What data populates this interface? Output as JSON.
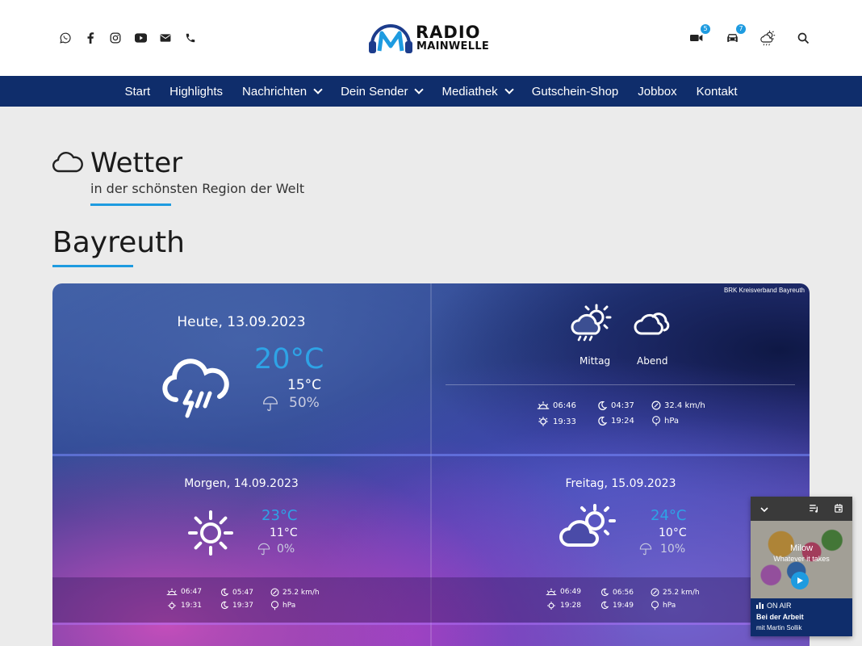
{
  "header": {
    "social": [
      "whatsapp-icon",
      "facebook-icon",
      "instagram-icon",
      "youtube-icon",
      "mail-icon",
      "phone-icon"
    ],
    "logo_line1": "RADIO",
    "logo_line2": "MAINWELLE",
    "tools": {
      "camera_badge": "5",
      "car_badge": "7"
    }
  },
  "nav": {
    "items": [
      {
        "label": "Start"
      },
      {
        "label": "Highlights"
      },
      {
        "label": "Nachrichten",
        "dropdown": true
      },
      {
        "label": "Dein Sender",
        "dropdown": true
      },
      {
        "label": "Mediathek",
        "dropdown": true
      },
      {
        "label": "Gutschein-Shop"
      },
      {
        "label": "Jobbox"
      },
      {
        "label": "Kontakt"
      }
    ]
  },
  "page": {
    "title": "Wetter",
    "subtitle": "in der schönsten Region der Welt",
    "city": "Bayreuth"
  },
  "weather": {
    "credit": "BRK Kreisverband Bayreuth",
    "today": {
      "date": "Heute, 13.09.2023",
      "high": "20°C",
      "low": "15°C",
      "rain": "50%",
      "mittag_label": "Mittag",
      "abend_label": "Abend",
      "sunrise": "06:46",
      "sunset": "19:33",
      "moonrise": "04:37",
      "moonset": "19:24",
      "wind": "32.4 km/h",
      "pressure": "hPa"
    },
    "tomorrow": {
      "date": "Morgen, 14.09.2023",
      "high": "23°C",
      "low": "11°C",
      "rain": "0%",
      "sunrise": "06:47",
      "sunset": "19:31",
      "moonrise": "05:47",
      "moonset": "19:37",
      "wind": "25.2 km/h",
      "pressure": "hPa"
    },
    "friday": {
      "date": "Freitag, 15.09.2023",
      "high": "24°C",
      "low": "10°C",
      "rain": "10%",
      "sunrise": "06:49",
      "sunset": "19:28",
      "moonrise": "06:56",
      "moonset": "19:49",
      "wind": "25.2 km/h",
      "pressure": "hPa"
    }
  },
  "player": {
    "artist": "Milow",
    "track": "Whatever it takes",
    "status": "ON AIR",
    "show": "Bei der Arbeit",
    "host": "mit Martin Sollik"
  },
  "colors": {
    "nav": "#0f2d6b",
    "accent": "#1e9be0"
  }
}
